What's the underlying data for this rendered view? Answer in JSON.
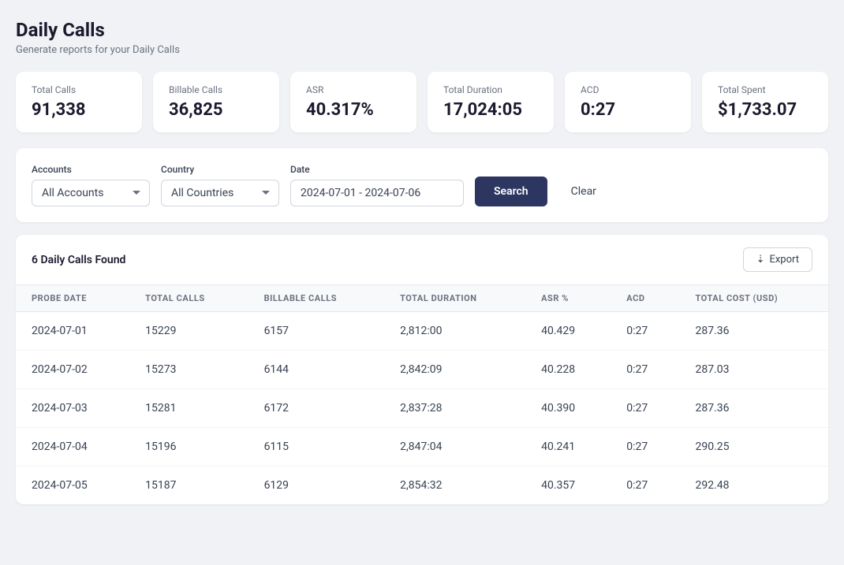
{
  "page": {
    "title": "Daily Calls",
    "subtitle": "Generate reports for your Daily Calls"
  },
  "stats": [
    {
      "label": "Total Calls",
      "value": "91,338"
    },
    {
      "label": "Billable Calls",
      "value": "36,825"
    },
    {
      "label": "ASR",
      "value": "40.317%"
    },
    {
      "label": "Total Duration",
      "value": "17,024:05"
    },
    {
      "label": "ACD",
      "value": "0:27"
    },
    {
      "label": "Total Spent",
      "value": "$1,733.07"
    }
  ],
  "filters": {
    "accounts_label": "Accounts",
    "accounts_value": "All Accounts",
    "country_label": "Country",
    "country_value": "All Countries",
    "date_label": "Date",
    "date_value": "2024-07-01 - 2024-07-06",
    "search_label": "Search",
    "clear_label": "Clear"
  },
  "results": {
    "count_label": "6 Daily Calls Found",
    "export_label": "Export",
    "columns": [
      "PROBE DATE",
      "TOTAL CALLS",
      "BILLABLE CALLS",
      "TOTAL DURATION",
      "ASR %",
      "ACD",
      "TOTAL COST (USD)"
    ],
    "rows": [
      {
        "date": "2024-07-01",
        "total_calls": "15229",
        "billable_calls": "6157",
        "total_duration": "2,812:00",
        "asr": "40.429",
        "acd": "0:27",
        "total_cost": "287.36"
      },
      {
        "date": "2024-07-02",
        "total_calls": "15273",
        "billable_calls": "6144",
        "total_duration": "2,842:09",
        "asr": "40.228",
        "acd": "0:27",
        "total_cost": "287.03"
      },
      {
        "date": "2024-07-03",
        "total_calls": "15281",
        "billable_calls": "6172",
        "total_duration": "2,837:28",
        "asr": "40.390",
        "acd": "0:27",
        "total_cost": "287.36"
      },
      {
        "date": "2024-07-04",
        "total_calls": "15196",
        "billable_calls": "6115",
        "total_duration": "2,847:04",
        "asr": "40.241",
        "acd": "0:27",
        "total_cost": "290.25"
      },
      {
        "date": "2024-07-05",
        "total_calls": "15187",
        "billable_calls": "6129",
        "total_duration": "2,854:32",
        "asr": "40.357",
        "acd": "0:27",
        "total_cost": "292.48"
      }
    ]
  }
}
